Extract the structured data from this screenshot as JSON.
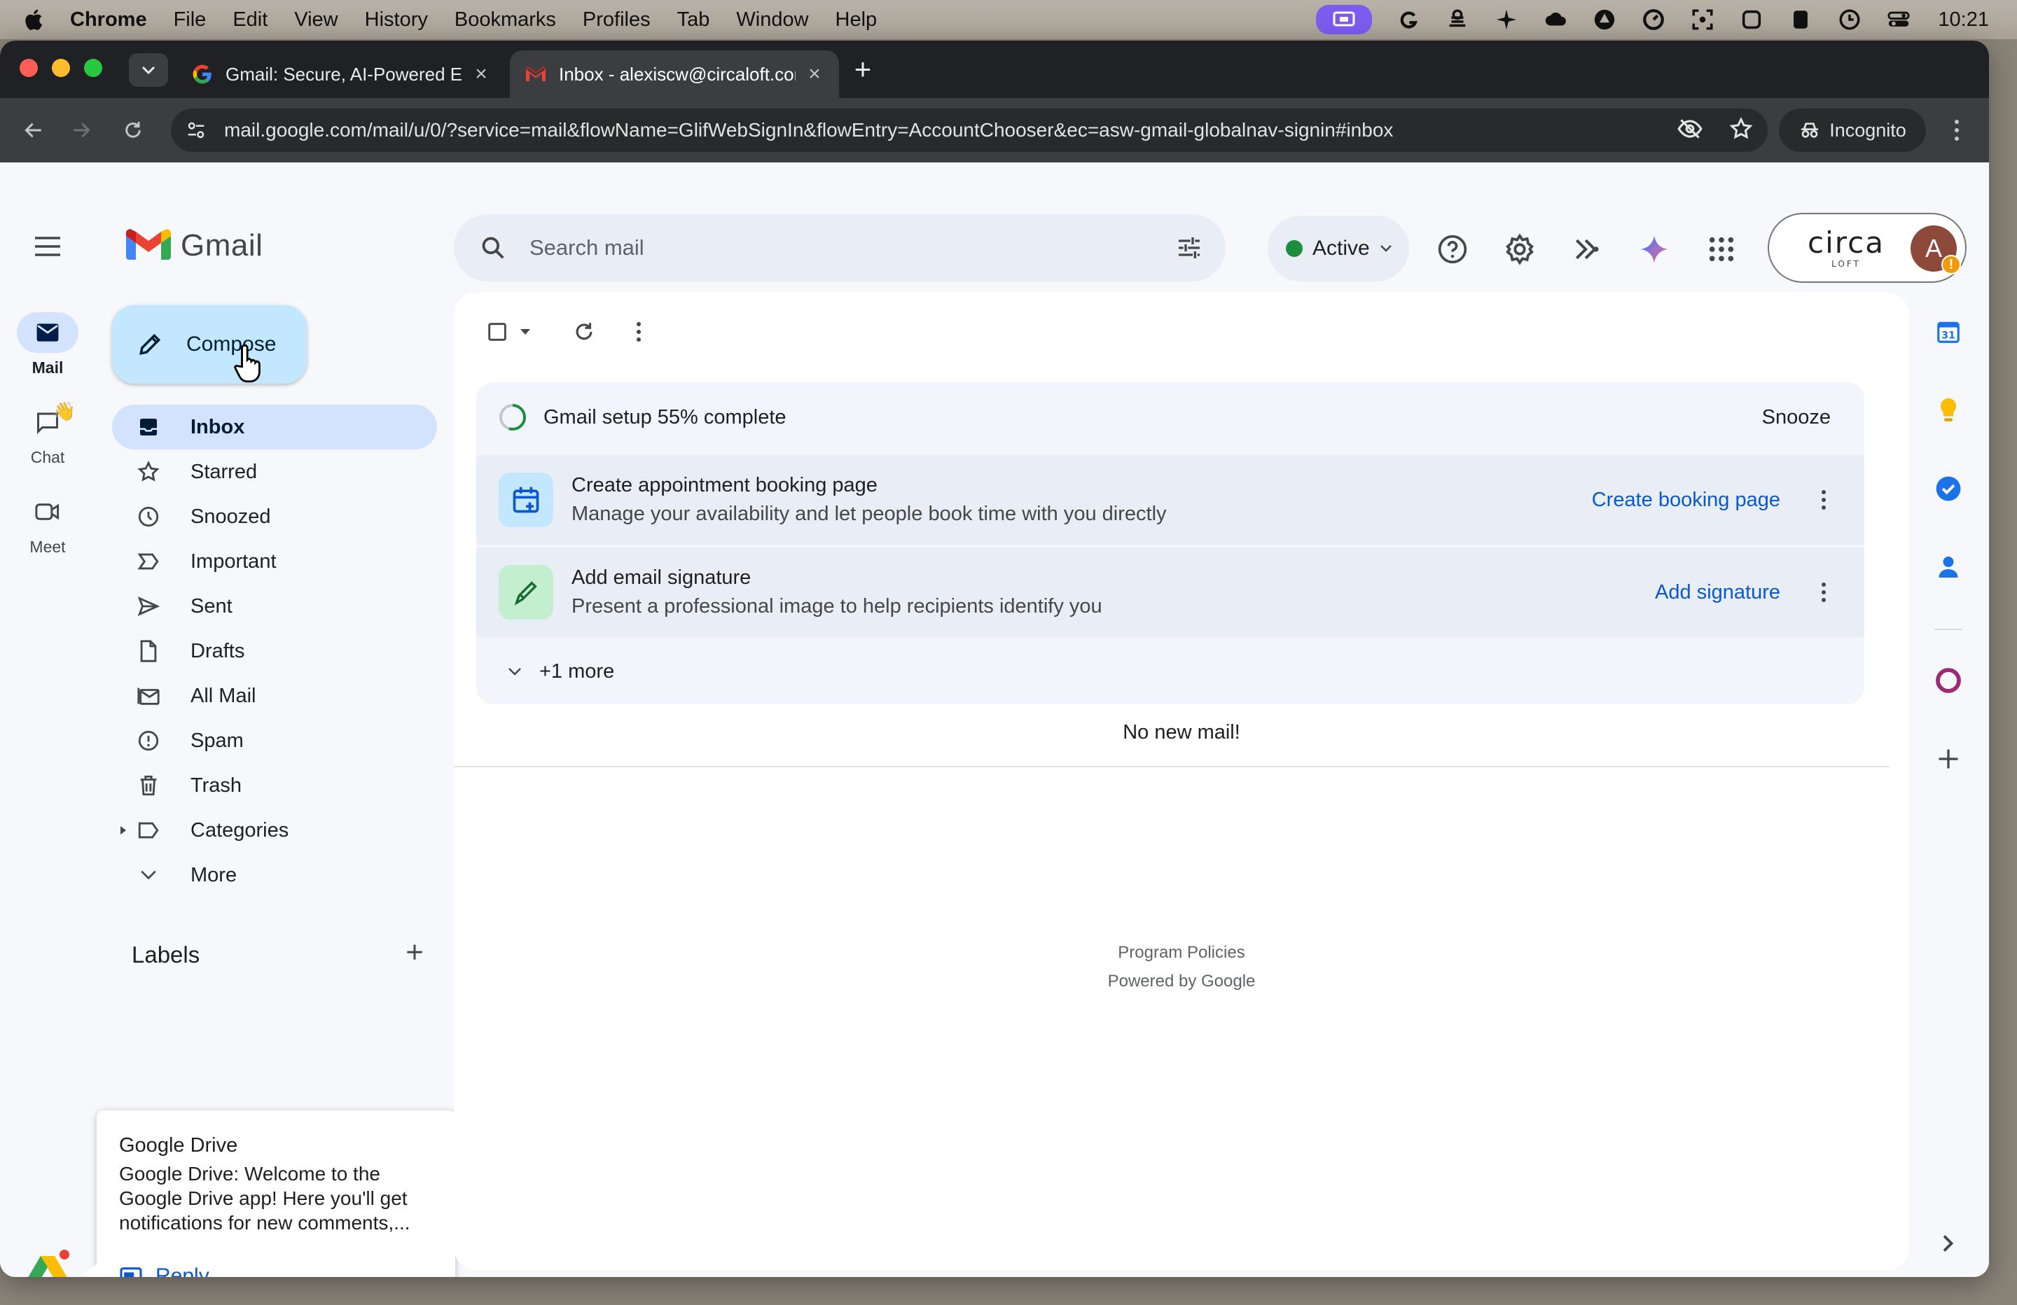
{
  "menubar": {
    "app": "Chrome",
    "items": [
      "File",
      "Edit",
      "View",
      "History",
      "Bookmarks",
      "Profiles",
      "Tab",
      "Window",
      "Help"
    ],
    "time": "10:21"
  },
  "browser": {
    "tabs": [
      {
        "title": "Gmail: Secure, AI-Powered Email",
        "favicon": "google-g-icon",
        "active": false
      },
      {
        "title": "Inbox - alexiscw@circaloft.com",
        "favicon": "gmail-icon",
        "active": true
      }
    ],
    "url": "mail.google.com/mail/u/0/?service=mail&flowName=GlifWebSignIn&flowEntry=AccountChooser&ec=asw-gmail-globalnav-signin#inbox",
    "incognito_label": "Incognito"
  },
  "gmail": {
    "logo_text": "Gmail",
    "search_placeholder": "Search mail",
    "status": "Active",
    "account_org": "circa",
    "account_org_sub": "LOFT",
    "avatar_letter": "A",
    "rail": [
      {
        "label": "Mail",
        "icon": "mail-icon"
      },
      {
        "label": "Chat",
        "icon": "chat-icon"
      },
      {
        "label": "Meet",
        "icon": "video-icon"
      }
    ],
    "compose_label": "Compose",
    "nav": [
      {
        "label": "Inbox",
        "icon": "inbox-icon"
      },
      {
        "label": "Starred",
        "icon": "star-icon"
      },
      {
        "label": "Snoozed",
        "icon": "clock-icon"
      },
      {
        "label": "Important",
        "icon": "important-icon"
      },
      {
        "label": "Sent",
        "icon": "send-icon"
      },
      {
        "label": "Drafts",
        "icon": "draft-icon"
      },
      {
        "label": "All Mail",
        "icon": "all-mail-icon"
      },
      {
        "label": "Spam",
        "icon": "spam-icon"
      },
      {
        "label": "Trash",
        "icon": "trash-icon"
      },
      {
        "label": "Categories",
        "icon": "label-icon"
      },
      {
        "label": "More",
        "icon": "chevron-down-icon"
      }
    ],
    "labels_title": "Labels",
    "setup": {
      "title": "Gmail setup 55% complete",
      "progress": 0.55,
      "snooze": "Snooze",
      "tasks": [
        {
          "title": "Create appointment booking page",
          "desc": "Manage your availability and let people book time with you directly",
          "action": "Create booking page"
        },
        {
          "title": "Add email signature",
          "desc": "Present a professional image to help recipients identify you",
          "action": "Add signature"
        }
      ],
      "more": "+1 more"
    },
    "empty_message": "No new mail!",
    "footer": {
      "policies": "Program Policies",
      "powered": "Powered by Google"
    },
    "toast": {
      "title": "Google Drive",
      "body": "Google Drive: Welcome to the Google Drive app! Here you'll get notifications for new comments,...",
      "reply": "Reply"
    },
    "calendar_day": "31"
  }
}
